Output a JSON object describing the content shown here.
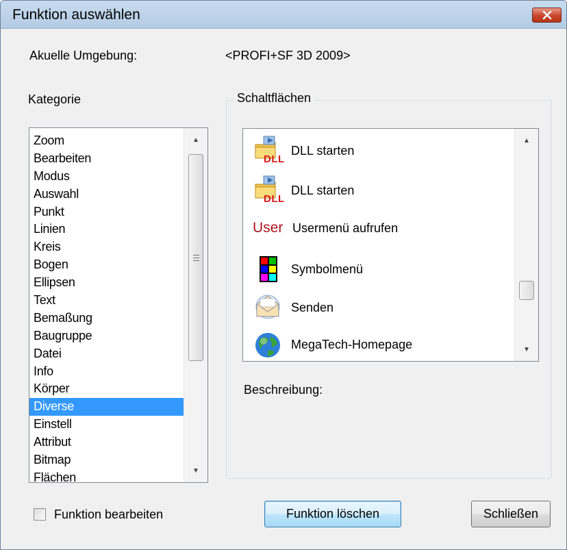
{
  "window": {
    "title": "Funktion auswählen",
    "close_symbol": "✕"
  },
  "environment": {
    "label": "Akuelle Umgebung:",
    "value": "<PROFI+SF 3D 2009>"
  },
  "category": {
    "label": "Kategorie",
    "items": [
      "Zoom",
      "Bearbeiten",
      "Modus",
      "Auswahl",
      "Punkt",
      "Linien",
      "Kreis",
      "Bogen",
      "Ellipsen",
      "Text",
      "Bemaßung",
      "Baugruppe",
      "Datei",
      "Info",
      "Körper",
      "Diverse",
      "Einstell",
      "Attribut",
      "Bitmap",
      "Flächen"
    ],
    "selected": "Diverse",
    "scroll_up_icon": "▲",
    "scroll_down_icon": "▼"
  },
  "buttons_panel": {
    "label": "Schaltflächen",
    "items": [
      {
        "label": "DLL starten",
        "icon": "dll-icon",
        "icon_text": "DLL"
      },
      {
        "label": "DLL starten",
        "icon": "dll-icon",
        "icon_text": "DLL"
      },
      {
        "label": "Usermenü aufrufen",
        "icon": "user-icon",
        "icon_text": "User"
      },
      {
        "label": "Symbolmenü",
        "icon": "symbol-grid-icon"
      },
      {
        "label": "Senden",
        "icon": "envelope-icon"
      },
      {
        "label": "MegaTech-Homepage",
        "icon": "globe-icon"
      }
    ],
    "scroll_up_icon": "▲",
    "scroll_down_icon": "▼"
  },
  "description": {
    "label": "Beschreibung:"
  },
  "footer": {
    "edit_checkbox_label": "Funktion bearbeiten",
    "delete_button": "Funktion löschen",
    "close_button": "Schließen"
  },
  "colors": {
    "selection": "#3399ff",
    "title_gradient_top": "#c9dcef",
    "close_button": "#c8452c"
  }
}
